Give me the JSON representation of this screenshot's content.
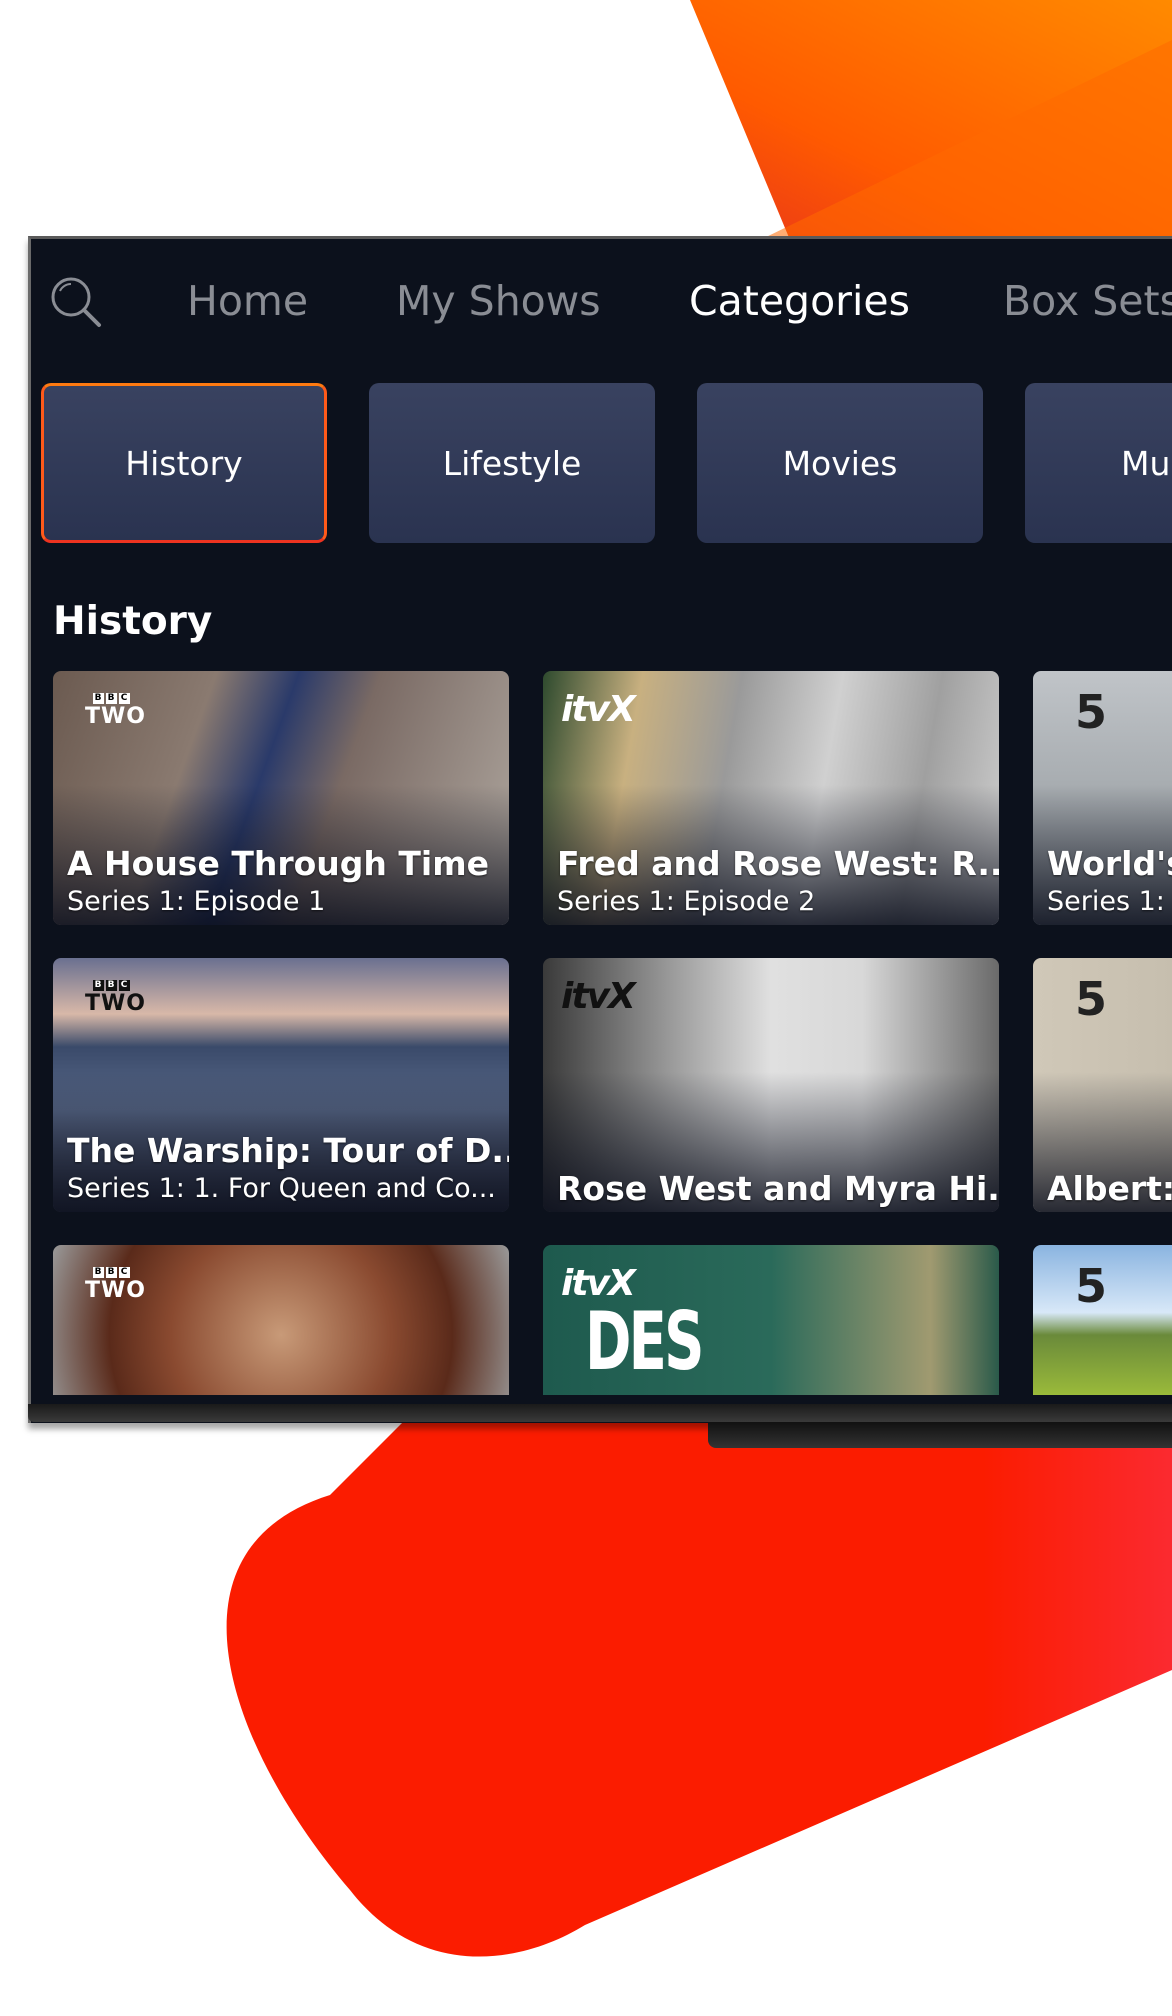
{
  "colors": {
    "screen_bg": "#0c111c",
    "accent_orange": "#ff6a00",
    "accent_red": "#ff1a00",
    "category_bg": "#333c5a",
    "nav_inactive": "#8a8d94",
    "nav_active": "#ffffff"
  },
  "nav": {
    "search_icon": "search-icon",
    "items": [
      {
        "label": "Home",
        "active": false
      },
      {
        "label": "My Shows",
        "active": false
      },
      {
        "label": "Categories",
        "active": true
      },
      {
        "label": "Box Sets",
        "active": false
      }
    ]
  },
  "categories": [
    {
      "label": "History",
      "selected": true
    },
    {
      "label": "Lifestyle",
      "selected": false
    },
    {
      "label": "Movies",
      "selected": false
    },
    {
      "label": "Music",
      "selected": false
    }
  ],
  "section": {
    "title": "History",
    "tiles": [
      [
        {
          "channel": "BBC TWO",
          "title": "A House Through Time",
          "subtitle": "Series 1: Episode 1"
        },
        {
          "channel": "itvX",
          "title": "Fred and Rose West: R...",
          "subtitle": "Series 1: Episode 2"
        },
        {
          "channel": "5",
          "title": "World's",
          "subtitle": "Series 1:"
        }
      ],
      [
        {
          "channel": "BBC TWO",
          "title": "The Warship: Tour of D...",
          "subtitle": "Series 1: 1. For Queen and Co..."
        },
        {
          "channel": "itvX",
          "title": "Rose West and Myra Hi...",
          "subtitle": ""
        },
        {
          "channel": "5",
          "title": "Albert:",
          "subtitle": ""
        }
      ],
      [
        {
          "channel": "BBC TWO",
          "title": "",
          "subtitle": ""
        },
        {
          "channel": "itvX",
          "title": "DES",
          "subtitle": ""
        },
        {
          "channel": "5",
          "title": "",
          "subtitle": ""
        }
      ]
    ]
  },
  "logos": {
    "bbc_blocks": [
      "B",
      "B",
      "C"
    ],
    "bbc_name": "TWO",
    "itv": "itvX",
    "five": "5",
    "des_art": "DES"
  }
}
